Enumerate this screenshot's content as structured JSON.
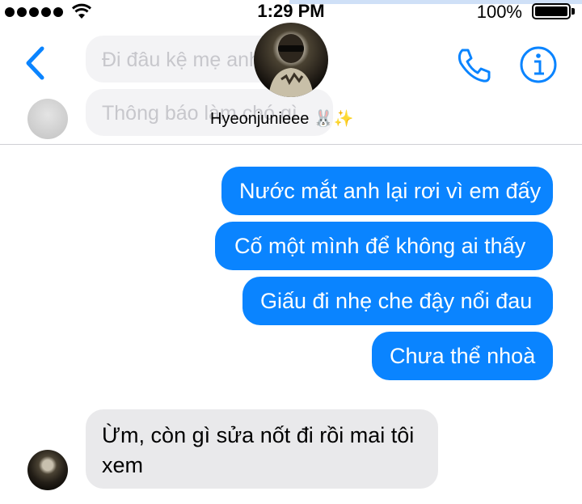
{
  "status_bar": {
    "time": "1:29 PM",
    "battery": "100%",
    "battery_level": 1.0
  },
  "header": {
    "back_icon": "chevron-left-icon",
    "contact_name": "Hyeonjunieee 🐰✨",
    "call_icon": "phone-icon",
    "info_icon": "info-icon",
    "accent_color": "#0a84ff"
  },
  "background_previews": [
    {
      "text": "Đi đâu kệ mẹ anh"
    },
    {
      "text": "Thông báo làm chó gì"
    }
  ],
  "messages": [
    {
      "side": "outgoing",
      "text": "Nước mắt anh lại rơi vì em đấy"
    },
    {
      "side": "outgoing",
      "text": "Cố một mình để không ai thấy"
    },
    {
      "side": "outgoing",
      "text": "Giấu đi nhẹ che đậy nổi đau"
    },
    {
      "side": "outgoing",
      "text": "Chưa thể nhoà"
    },
    {
      "side": "incoming",
      "text": "Ừm, còn gì sửa nốt đi rồi mai tôi xem"
    }
  ],
  "colors": {
    "outgoing_bubble": "#0a84ff",
    "incoming_bubble": "#e9e9eb"
  }
}
